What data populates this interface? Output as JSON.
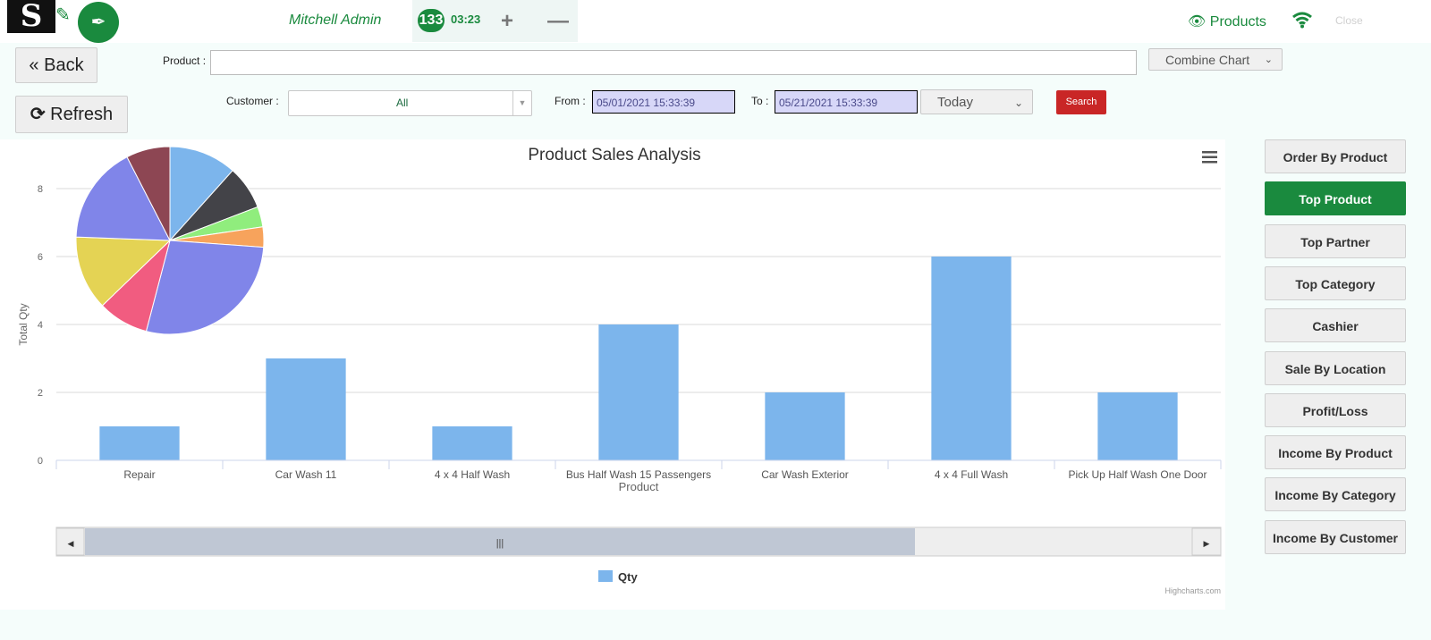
{
  "header": {
    "logo": "S",
    "user": "Mitchell Admin",
    "count": "133",
    "clock": "03:23",
    "products_link": "Products",
    "close_link": "Close"
  },
  "toolbar": {
    "back_label": "Back",
    "refresh_label": "Refresh",
    "product_label": "Product :",
    "customer_label": "Customer :",
    "customer_value": "All",
    "from_label": "From :",
    "from_value": "05/01/2021 15:33:39",
    "to_label": "To :",
    "to_value": "05/21/2021 15:33:39",
    "period_value": "Today",
    "combine_value": "Combine Chart",
    "search_label": "Search"
  },
  "sidebar": {
    "items": [
      {
        "label": "Order By Product",
        "active": false
      },
      {
        "label": "Top Product",
        "active": true
      },
      {
        "label": "Top Partner",
        "active": false
      },
      {
        "label": "Top Category",
        "active": false
      },
      {
        "label": "Cashier",
        "active": false
      },
      {
        "label": "Sale By Location",
        "active": false
      },
      {
        "label": "Profit/Loss",
        "active": false
      },
      {
        "label": "Income By Product",
        "active": false
      },
      {
        "label": "Income By Category",
        "active": false
      },
      {
        "label": "Income By Customer",
        "active": false
      }
    ]
  },
  "chart_data": {
    "type": "bar",
    "title": "Product Sales Analysis",
    "xlabel": "Product",
    "ylabel": "Total Qty",
    "ylim": [
      0,
      8
    ],
    "yticks": [
      0,
      2,
      4,
      6,
      8
    ],
    "categories": [
      "Repair",
      "Car Wash 11",
      "4 x 4 Half Wash",
      "Bus Half Wash 15 Passengers",
      "Car Wash Exterior",
      "4 x 4 Full Wash",
      "Pick Up Half Wash One Door"
    ],
    "series": [
      {
        "name": "Qty",
        "values": [
          1,
          3,
          1,
          4,
          2,
          6,
          2
        ],
        "color": "#7cb5ec"
      }
    ],
    "grid": true,
    "legend": "bottom-center",
    "credits": "Highcharts.com",
    "scrollbar_thumb_glyph": "|||",
    "pie": {
      "slices": [
        {
          "value": 1,
          "color": "#7cb5ec"
        },
        {
          "value": 0.65,
          "color": "#434348"
        },
        {
          "value": 0.3,
          "color": "#90ed7d"
        },
        {
          "value": 0.3,
          "color": "#f7a35c"
        },
        {
          "value": 2.4,
          "color": "#8085e9"
        },
        {
          "value": 0.75,
          "color": "#f15c80"
        },
        {
          "value": 1.1,
          "color": "#e4d354"
        },
        {
          "value": 1.45,
          "color": "#8085e9"
        },
        {
          "value": 0.65,
          "color": "#8d4653"
        }
      ]
    }
  }
}
